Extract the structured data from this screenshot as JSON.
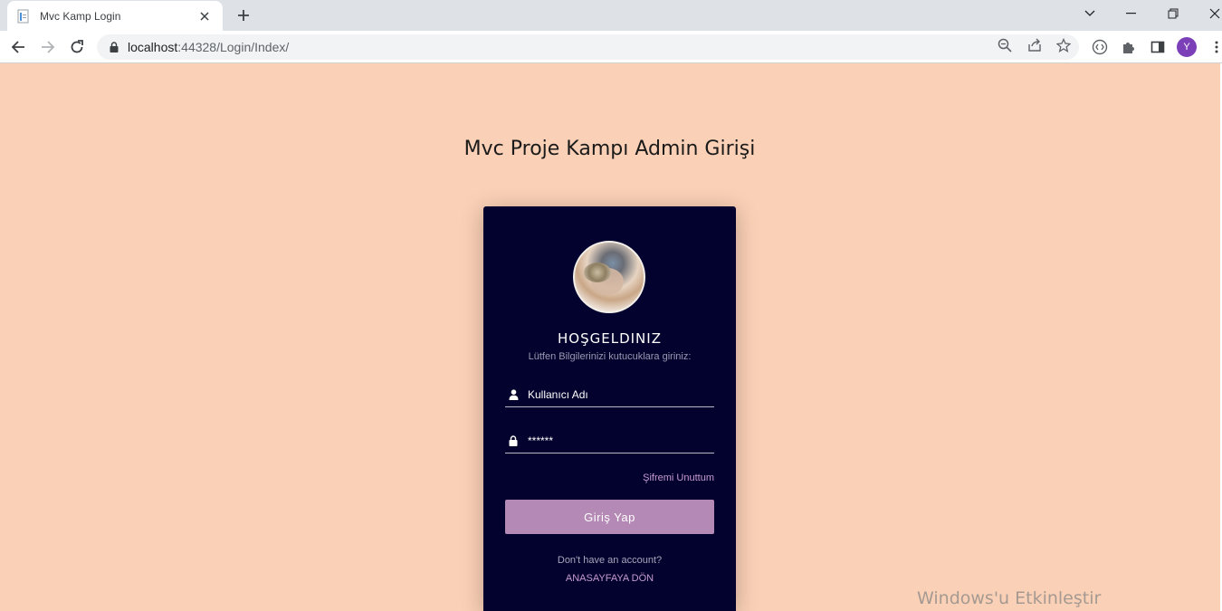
{
  "browser": {
    "tab_title": "Mvc Kamp Login",
    "url_host": "localhost",
    "url_path": ":44328/Login/Index/",
    "profile_initial": "Y"
  },
  "page": {
    "title": "Mvc Proje Kampı Admin Girişi"
  },
  "login": {
    "welcome": "HOŞGELDINIZ",
    "subtitle": "Lütfen Bilgilerinizi kutucuklara giriniz:",
    "username_placeholder": "Kullanıcı Adı",
    "password_placeholder": "******",
    "forgot_label": "Şifremi Unuttum",
    "submit_label": "Giriş Yap",
    "no_account_text": "Don't have an account?",
    "home_link_label": "ANASAYFAYA DÖN"
  },
  "os": {
    "watermark": "Windows'u Etkinleştir"
  },
  "colors": {
    "page_bg": "#fad0b6",
    "card_bg": "#03022e",
    "button_bg": "#b589b5",
    "link_color": "#c79ad1"
  }
}
